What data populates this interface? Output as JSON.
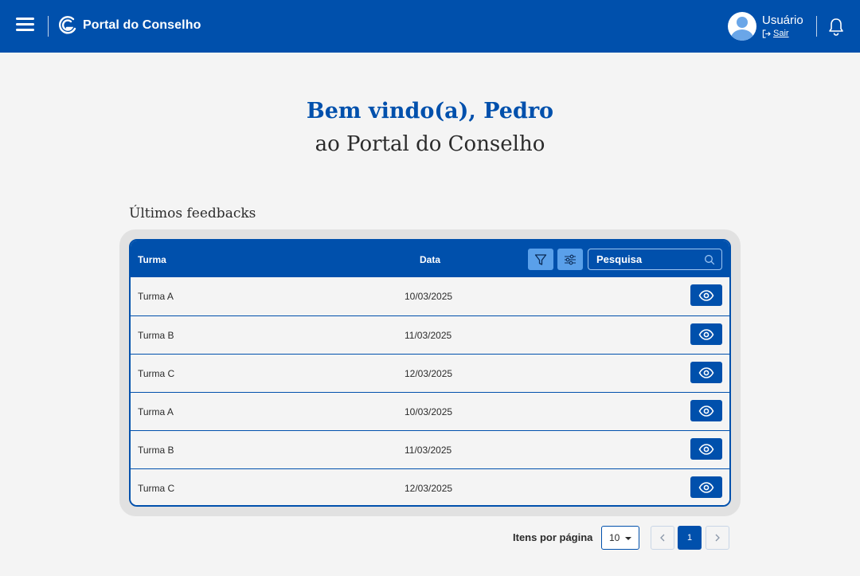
{
  "header": {
    "brand": "Portal do Conselho",
    "user_name": "Usuário",
    "logout_label": "Sair",
    "color": "#0050ac"
  },
  "welcome": {
    "line1": "Bem vindo(a), Pedro",
    "line2": "ao Portal do Conselho"
  },
  "feedbacks": {
    "title": "Últimos feedbacks",
    "columns": {
      "turma": "Turma",
      "data": "Data"
    },
    "search_placeholder": "Pesquisa",
    "rows": [
      {
        "turma": "Turma A",
        "data": "10/03/2025"
      },
      {
        "turma": "Turma B",
        "data": "11/03/2025"
      },
      {
        "turma": "Turma C",
        "data": "12/03/2025"
      },
      {
        "turma": "Turma A",
        "data": "10/03/2025"
      },
      {
        "turma": "Turma B",
        "data": "11/03/2025"
      },
      {
        "turma": "Turma C",
        "data": "12/03/2025"
      }
    ]
  },
  "pagination": {
    "items_label": "Itens por página",
    "per_page": "10",
    "current_page": "1"
  },
  "icons": [
    "menu-icon",
    "brand-logo-icon",
    "avatar-icon",
    "logout-icon",
    "bell-icon",
    "filter-icon",
    "sliders-icon",
    "search-icon",
    "eye-icon",
    "chevron-left-icon",
    "chevron-right-icon",
    "caret-down-icon"
  ]
}
